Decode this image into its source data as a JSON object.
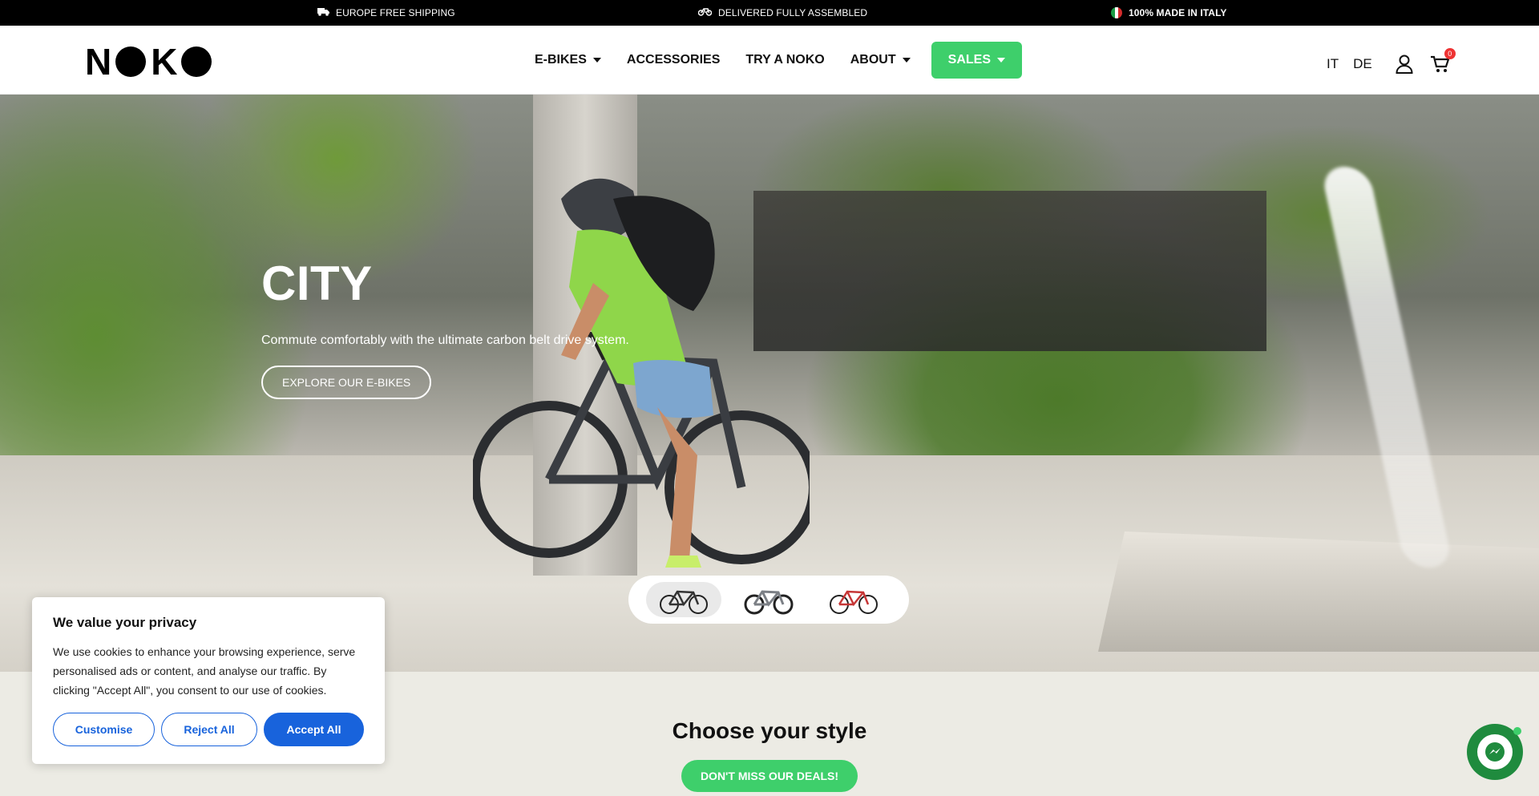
{
  "topbar": {
    "shipping": "Europe free shipping",
    "assembled": "Delivered fully assembled",
    "made_in": "100% made in Italy",
    "icons": [
      "truck-icon",
      "bike-icon",
      "italy-flag-icon"
    ]
  },
  "header": {
    "logo": "NOKO",
    "nav": [
      {
        "label": "E-Bikes",
        "has_dropdown": true
      },
      {
        "label": "Accessories",
        "has_dropdown": false
      },
      {
        "label": "Try a Noko",
        "has_dropdown": false
      },
      {
        "label": "About",
        "has_dropdown": true
      },
      {
        "label": "Sales",
        "has_dropdown": true
      }
    ],
    "languages": [
      "IT",
      "DE"
    ],
    "cart_count": "0",
    "accent": "#3ecf6b"
  },
  "hero": {
    "title": "CITY",
    "subtitle": "Commute comfortably with the ultimate carbon belt drive system.",
    "cta": "Explore our e-bikes",
    "bike_options": [
      "city-bike-icon",
      "trekking-bike-icon",
      "road-bike-icon"
    ],
    "active_option": 0
  },
  "section": {
    "title": "Choose your style",
    "deals": "Don't miss our deals!"
  },
  "cookie": {
    "title": "We value your privacy",
    "body": "We use cookies to enhance your browsing experience, serve personalised ads or content, and analyse our traffic. By clicking \"Accept All\", you consent to our use of cookies.",
    "customise": "Customise",
    "reject": "Reject All",
    "accept": "Accept All",
    "accent": "#1863dc"
  }
}
